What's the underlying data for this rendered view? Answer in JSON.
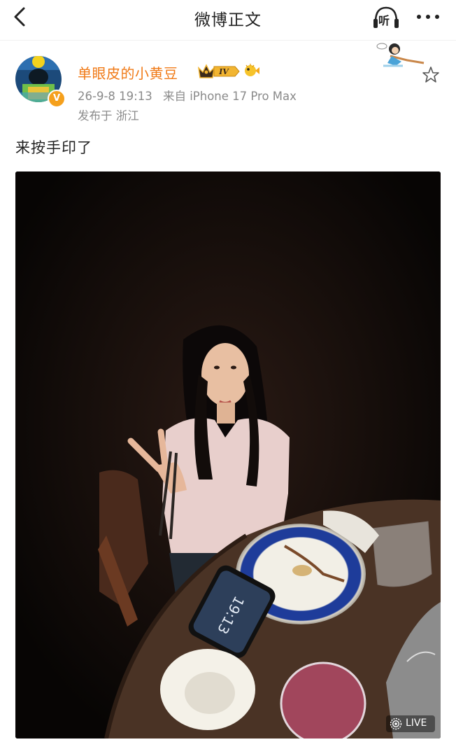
{
  "header": {
    "back_icon": "chevron-left-icon",
    "title": "微博正文",
    "listen_label": "听",
    "more_icon": "more-dots-icon"
  },
  "author": {
    "name": "单眼皮的小黄豆",
    "vip_level": "IV",
    "verified_icon": "verified-v-badge",
    "verified_label": "V",
    "timestamp": "26-9-8 19:13",
    "source": "来自 iPhone 17 Pro Max",
    "location": "发布于 浙江"
  },
  "post": {
    "text": "来按手印了",
    "photo_badge": "LIVE",
    "favorite_icon": "star-outline-icon"
  },
  "colors": {
    "username": "#f07a17",
    "meta": "#8a8a8a",
    "vip_gold": "#f2b531"
  }
}
